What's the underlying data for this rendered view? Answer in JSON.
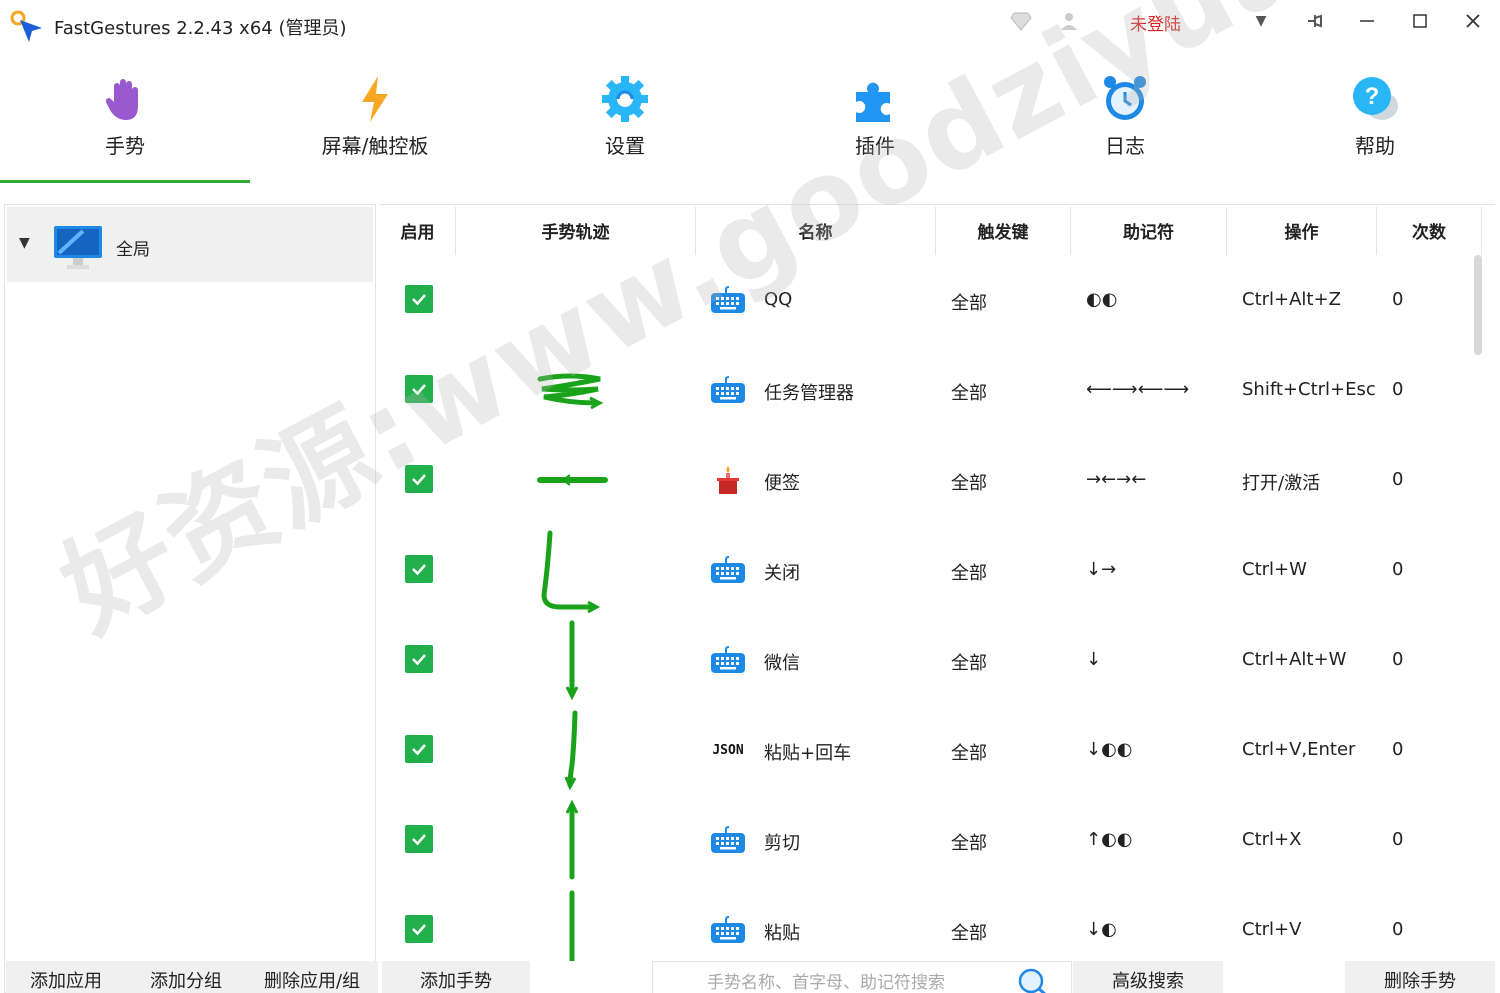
{
  "window": {
    "title": "FastGestures 2.2.43 x64  (管理员)",
    "login_label": "未登陆"
  },
  "nav": {
    "tabs": [
      {
        "label": "手势",
        "icon": "hand-icon",
        "active": true
      },
      {
        "label": "屏幕/触控板",
        "icon": "lightning-icon"
      },
      {
        "label": "设置",
        "icon": "gear-icon"
      },
      {
        "label": "插件",
        "icon": "puzzle-icon"
      },
      {
        "label": "日志",
        "icon": "alarm-clock-icon"
      },
      {
        "label": "帮助",
        "icon": "help-bubble-icon"
      }
    ]
  },
  "sidebar": {
    "tree": [
      {
        "label": "全局",
        "expanded": true,
        "icon": "monitor-icon"
      }
    ]
  },
  "table": {
    "headers": [
      "启用",
      "手势轨迹",
      "名称",
      "触发键",
      "助记符",
      "操作",
      "次数"
    ],
    "rows": [
      {
        "enabled": true,
        "icon": "keyboard-icon",
        "name": "QQ",
        "trigger": "全部",
        "mnemonic": "◐◐",
        "action": "Ctrl+Alt+Z",
        "count": "0"
      },
      {
        "enabled": true,
        "icon": "keyboard-icon",
        "name": "任务管理器",
        "trigger": "全部",
        "mnemonic": "⟵⟶⟵⟶",
        "action": "Shift+Ctrl+Esc",
        "count": "0"
      },
      {
        "enabled": true,
        "icon": "sticky-note-icon",
        "name": "便签",
        "trigger": "全部",
        "mnemonic": "→←→←",
        "action": "打开/激活",
        "count": "0"
      },
      {
        "enabled": true,
        "icon": "keyboard-icon",
        "name": "关闭",
        "trigger": "全部",
        "mnemonic": "↓→",
        "action": "Ctrl+W",
        "count": "0"
      },
      {
        "enabled": true,
        "icon": "keyboard-icon",
        "name": "微信",
        "trigger": "全部",
        "mnemonic": "↓",
        "action": "Ctrl+Alt+W",
        "count": "0"
      },
      {
        "enabled": true,
        "icon": "json-icon",
        "icon_text": "JSON",
        "name": "粘贴+回车",
        "trigger": "全部",
        "mnemonic": "↓◐◐",
        "action": "Ctrl+V,Enter",
        "count": "0"
      },
      {
        "enabled": true,
        "icon": "keyboard-icon",
        "name": "剪切",
        "trigger": "全部",
        "mnemonic": "↑◐◐",
        "action": "Ctrl+X",
        "count": "0"
      },
      {
        "enabled": true,
        "icon": "keyboard-icon",
        "name": "粘贴",
        "trigger": "全部",
        "mnemonic": "↓◐",
        "action": "Ctrl+V",
        "count": "0"
      }
    ]
  },
  "bottom": {
    "add_app": "添加应用",
    "add_group": "添加分组",
    "delete_app_group": "删除应用/组",
    "add_gesture": "添加手势",
    "search_placeholder": "手势名称、首字母、助记符搜索",
    "advanced_search": "高级搜索",
    "delete_gesture": "删除手势"
  },
  "watermark": "好资源:www.goodziyuan.com",
  "colors": {
    "accent_green": "#33aa33",
    "check_green": "#21b04b",
    "gesture_green": "#1aa31a",
    "login_red": "#e02020",
    "keyboard_blue": "#1e88e5"
  }
}
